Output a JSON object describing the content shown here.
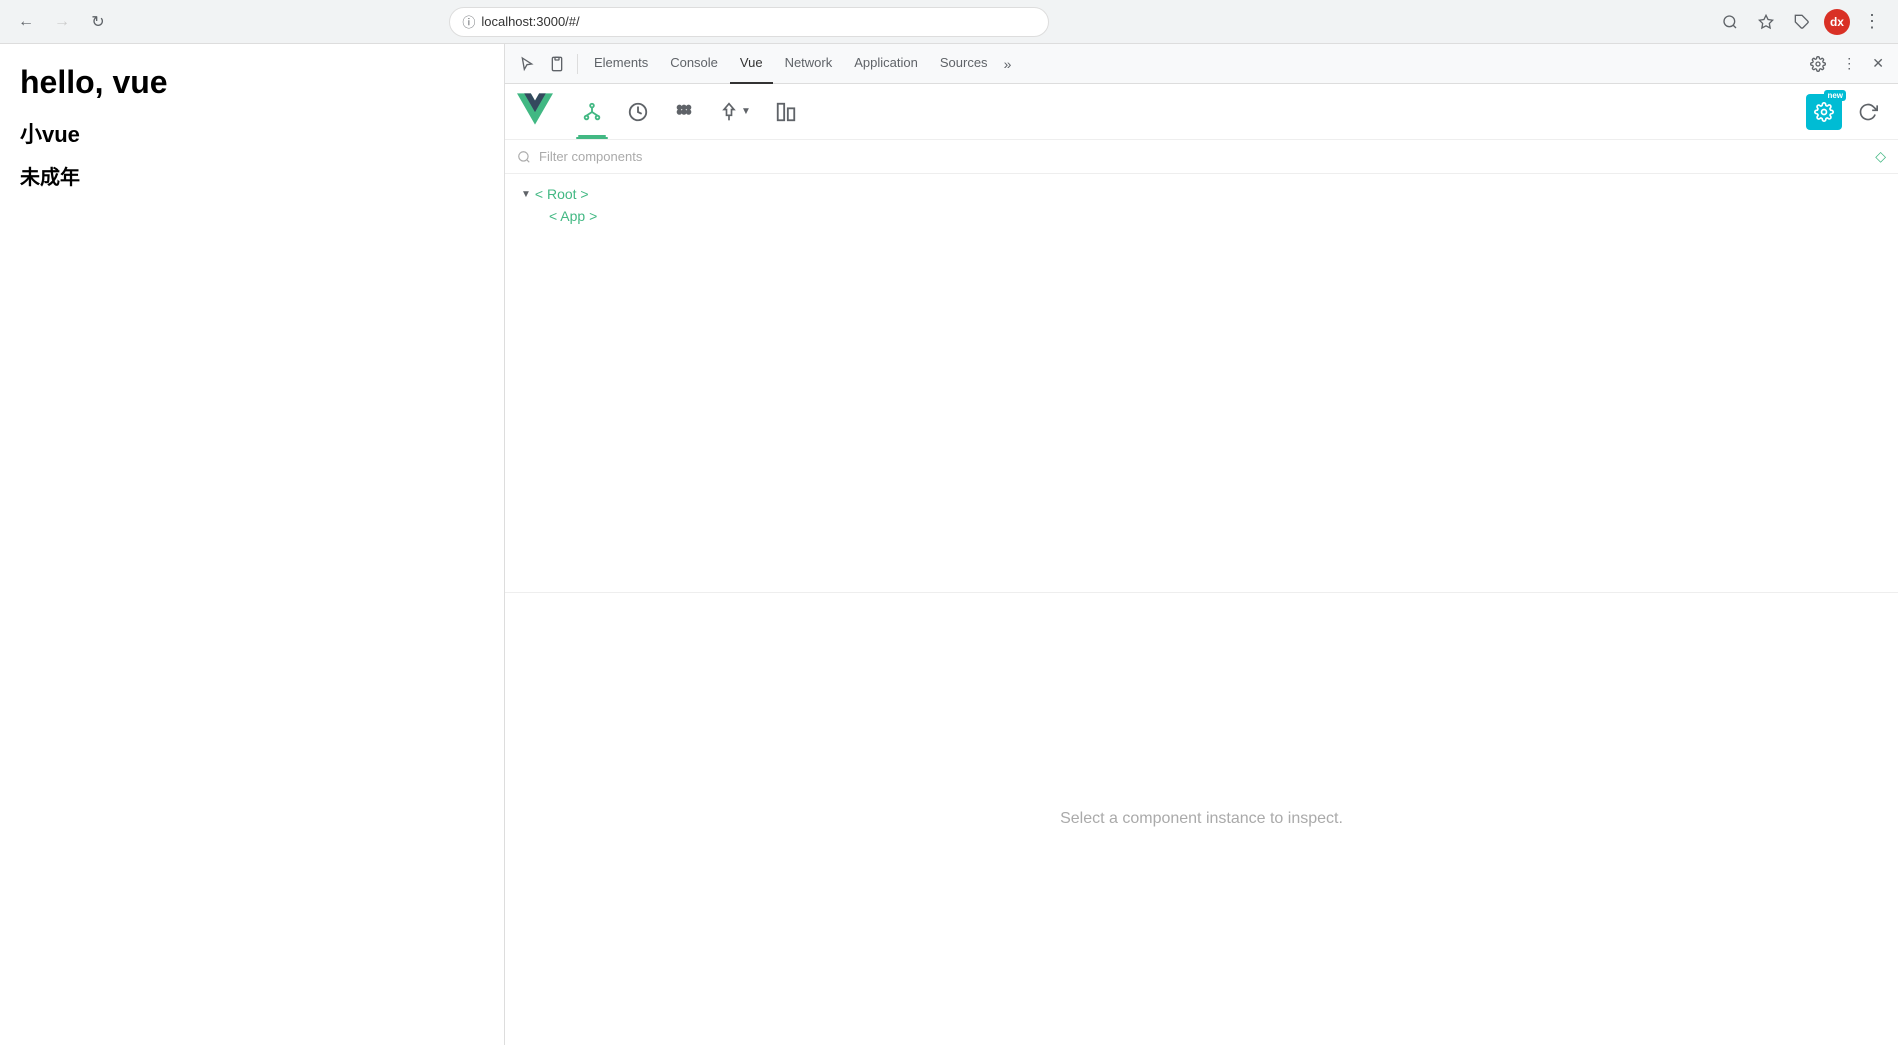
{
  "browser": {
    "url": "localhost:3000/#/",
    "back_disabled": false,
    "forward_disabled": true,
    "avatar_text": "dx"
  },
  "page": {
    "title": "hello, vue",
    "subtitle": "小vue",
    "text": "未成年"
  },
  "devtools": {
    "tabs": [
      {
        "id": "elements",
        "label": "Elements",
        "active": false
      },
      {
        "id": "console",
        "label": "Console",
        "active": false
      },
      {
        "id": "vue",
        "label": "Vue",
        "active": true
      },
      {
        "id": "network",
        "label": "Network",
        "active": false
      },
      {
        "id": "application",
        "label": "Application",
        "active": false
      },
      {
        "id": "sources",
        "label": "Sources",
        "active": false
      }
    ],
    "vue": {
      "toolbar_buttons": [
        {
          "id": "component-tree",
          "title": "Component Tree"
        },
        {
          "id": "vuex",
          "title": "Vuex"
        },
        {
          "id": "events",
          "title": "Events"
        },
        {
          "id": "routing",
          "title": "Routing"
        },
        {
          "id": "performance",
          "title": "Performance"
        },
        {
          "id": "settings",
          "title": "Settings",
          "new": true
        }
      ],
      "filter_placeholder": "Filter components",
      "tree": {
        "root_label": "< Root >",
        "app_label": "< App >"
      },
      "inspector_placeholder": "Select a component instance to inspect."
    }
  }
}
